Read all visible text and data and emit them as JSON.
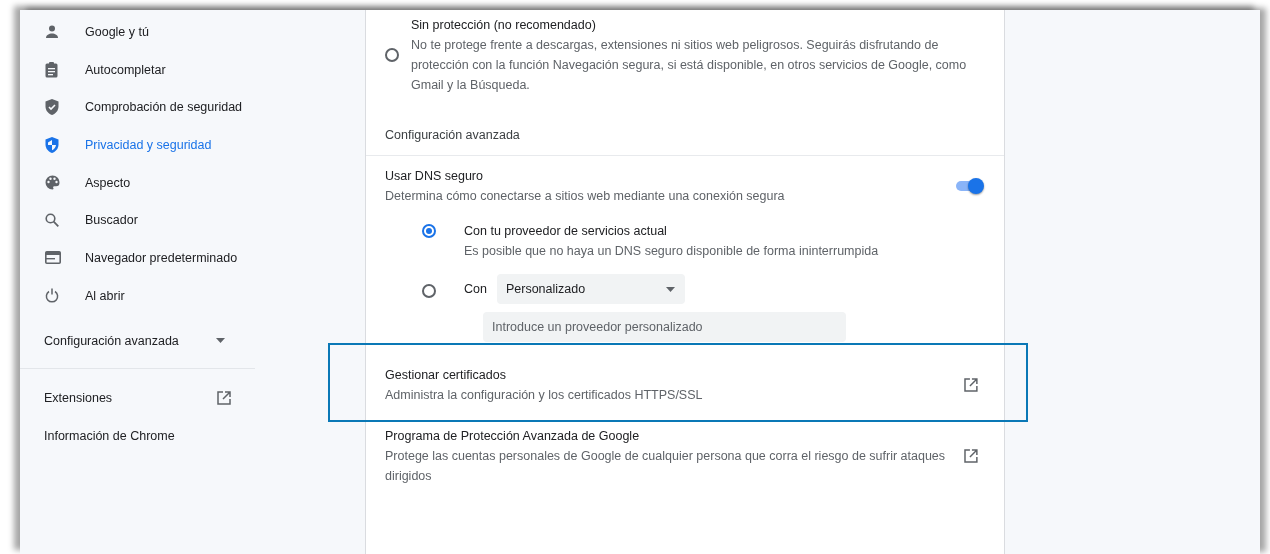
{
  "sidebar": {
    "items": [
      {
        "label": "Google y tú",
        "kind": "person",
        "selected": false
      },
      {
        "label": "Autocompletar",
        "kind": "clipboard",
        "selected": false
      },
      {
        "label": "Comprobación de seguridad",
        "kind": "shield-check",
        "selected": false
      },
      {
        "label": "Privacidad y seguridad",
        "kind": "shield",
        "selected": true
      },
      {
        "label": "Aspecto",
        "kind": "palette",
        "selected": false
      },
      {
        "label": "Buscador",
        "kind": "search",
        "selected": false
      },
      {
        "label": "Navegador predeterminado",
        "kind": "browser",
        "selected": false
      },
      {
        "label": "Al abrir",
        "kind": "power",
        "selected": false
      }
    ],
    "advanced": {
      "label": "Configuración avanzada",
      "expanded": false
    },
    "links": [
      {
        "label": "Extensiones",
        "external": true
      },
      {
        "label": "Información de Chrome",
        "external": false
      }
    ]
  },
  "main": {
    "no_protection": {
      "title": "Sin protección (no recomendado)",
      "description": "No te protege frente a descargas, extensiones ni sitios web peligrosos. Seguirás disfrutando de protección con la función Navegación segura, si está disponible, en otros servicios de Google, como Gmail y la Búsqueda.",
      "selected": false
    },
    "section_title": "Configuración avanzada",
    "dns": {
      "title": "Usar DNS seguro",
      "description": "Determina cómo conectarse a sitios web mediante una conexión segura",
      "on": true,
      "options": [
        {
          "kind": "current",
          "label": "Con tu proveedor de servicios actual",
          "description": "Es posible que no haya un DNS seguro disponible de forma ininterrumpida",
          "selected": true
        },
        {
          "kind": "custom",
          "label": "Con",
          "dropdown": "Personalizado",
          "placeholder": "Introduce un proveedor personalizado",
          "selected": false
        }
      ]
    },
    "links": [
      {
        "title": "Gestionar certificados",
        "description": "Administra la configuración y los certificados HTTPS/SSL",
        "highlighted": true
      },
      {
        "title": "Programa de Protección Avanzada de Google",
        "description": "Protege las cuentas personales de Google de cualquier persona que corra el riesgo de sufrir ataques dirigidos",
        "highlighted": false
      }
    ]
  }
}
